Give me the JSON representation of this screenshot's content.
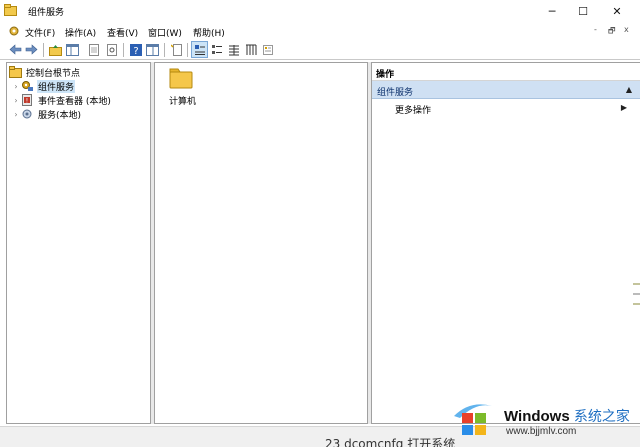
{
  "window": {
    "title": "组件服务",
    "minimize_glyph": "─",
    "maximize_glyph": "☐",
    "close_glyph": "✕"
  },
  "menu": {
    "items": [
      "文件(F)",
      "操作(A)",
      "查看(V)",
      "窗口(W)",
      "帮助(H)"
    ],
    "mdi_minimize": "-",
    "mdi_restore": "🗗",
    "mdi_close": "x"
  },
  "toolbar": {
    "buttons": [
      "back-icon",
      "forward-icon",
      "up-folder-icon",
      "show-tree-icon",
      "export-icon",
      "properties-icon",
      "help-icon",
      "console-tree-icon",
      "new-window-icon",
      "large-icons-icon",
      "small-icons-icon",
      "list-view-icon",
      "detail-view-icon",
      "configure-icon"
    ]
  },
  "tree": {
    "root": "控制台根节点",
    "items": [
      {
        "label": "组件服务",
        "icon": "component-services-icon",
        "selected": true
      },
      {
        "label": "事件查看器 (本地)",
        "icon": "event-viewer-icon",
        "selected": false
      },
      {
        "label": "服务(本地)",
        "icon": "services-icon",
        "selected": false
      }
    ],
    "expand_glyph": "›"
  },
  "middle": {
    "items": [
      {
        "label": "计算机",
        "icon": "folder-icon"
      }
    ]
  },
  "actions": {
    "header": "操作",
    "section": "组件服务",
    "collapse_glyph": "▲",
    "items": [
      {
        "label": "更多操作",
        "arrow": "▶"
      }
    ]
  },
  "background": {
    "cut_text": "23 dcomcnfg 打开系统"
  },
  "watermark": {
    "title": "Windows",
    "title2": "系统之家",
    "url": "www.bjjmlv.com"
  },
  "colors": {
    "selection": "#cce4f7",
    "action_section": "#cfe0f3",
    "folder": "#f5c74a"
  }
}
